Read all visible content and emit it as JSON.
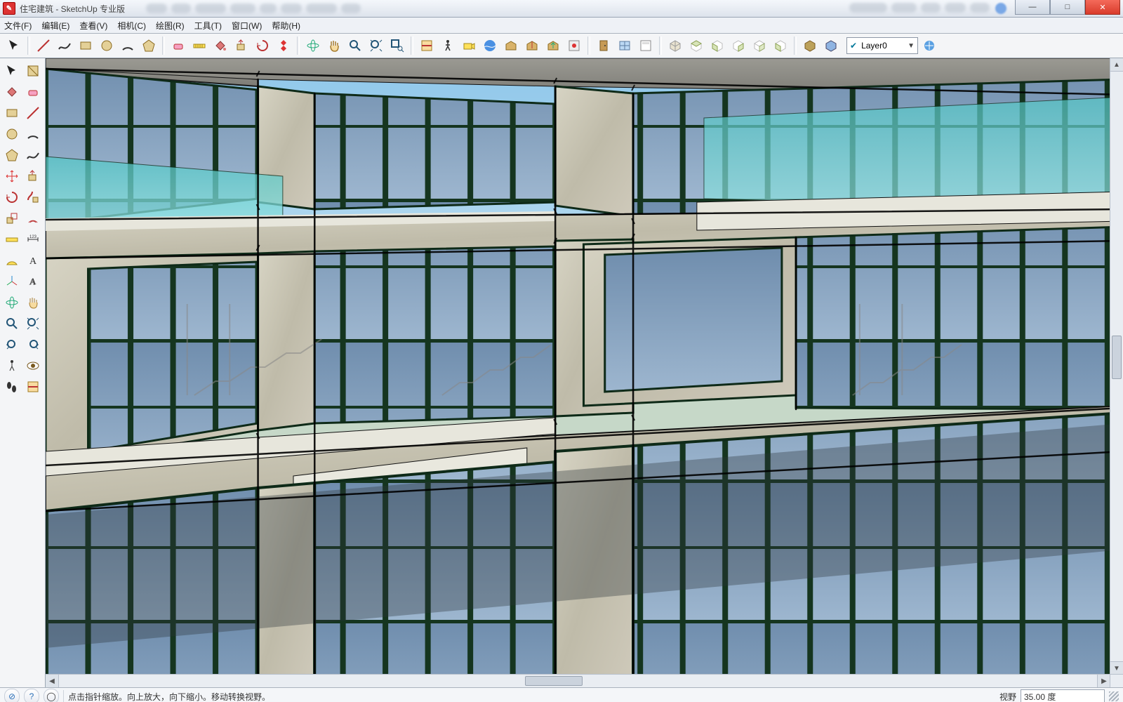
{
  "title": "住宅建筑 - SketchUp 专业版",
  "menus": [
    "文件(F)",
    "编辑(E)",
    "查看(V)",
    "相机(C)",
    "绘图(R)",
    "工具(T)",
    "窗口(W)",
    "帮助(H)"
  ],
  "status_hint": "点击指针缩放。向上放大，向下缩小。移动转换视野。",
  "status_field_label": "视野",
  "status_field_value": "35.00 度",
  "layer_current": "Layer0",
  "top_tool_names": [
    "select-tool",
    "line-tool",
    "freehand-tool",
    "rectangle-tool",
    "circle-tool",
    "arc-tool",
    "polygon-tool",
    "eraser-tool",
    "tape-measure-tool",
    "paint-bucket-tool",
    "push-pull-tool",
    "rotate-tool",
    "curic-tool",
    "orbit-tool",
    "pan-tool",
    "zoom-tool",
    "zoom-extents-tool",
    "zoom-window-tool",
    "section-tool",
    "walk-tool",
    "position-camera-tool",
    "google-earth-tool",
    "3d-warehouse-tool",
    "share-tool",
    "warehouse-upload-tool",
    "extension-tool",
    "door-icon",
    "window-icon",
    "panel-icon",
    "view-iso-icon",
    "view-top-icon",
    "view-front-icon",
    "view-right-icon",
    "view-back-icon",
    "view-left-icon",
    "style-shaded-icon",
    "style-textured-icon"
  ],
  "side_tool_rows": [
    [
      "select-tool",
      "make-component-tool"
    ],
    [
      "paint-bucket-tool",
      "eraser-tool"
    ],
    [
      "rectangle-tool",
      "line-tool"
    ],
    [
      "circle-tool",
      "arc-tool"
    ],
    [
      "polygon-tool",
      "freehand-tool"
    ],
    [
      "move-tool",
      "push-pull-tool"
    ],
    [
      "rotate-tool",
      "follow-me-tool"
    ],
    [
      "scale-tool",
      "offset-tool"
    ],
    [
      "tape-measure-tool",
      "dimension-tool"
    ],
    [
      "protractor-tool",
      "text-tool"
    ],
    [
      "axes-tool",
      "3d-text-tool"
    ],
    [
      "orbit-tool",
      "pan-tool"
    ],
    [
      "zoom-tool",
      "zoom-extents-tool"
    ],
    [
      "previous-view-tool",
      "next-view-tool"
    ],
    [
      "position-camera-tool",
      "look-around-tool"
    ],
    [
      "walk-tool",
      "section-plane-tool"
    ]
  ],
  "win_buttons": {
    "min": "—",
    "max": "□",
    "close": "✕"
  }
}
